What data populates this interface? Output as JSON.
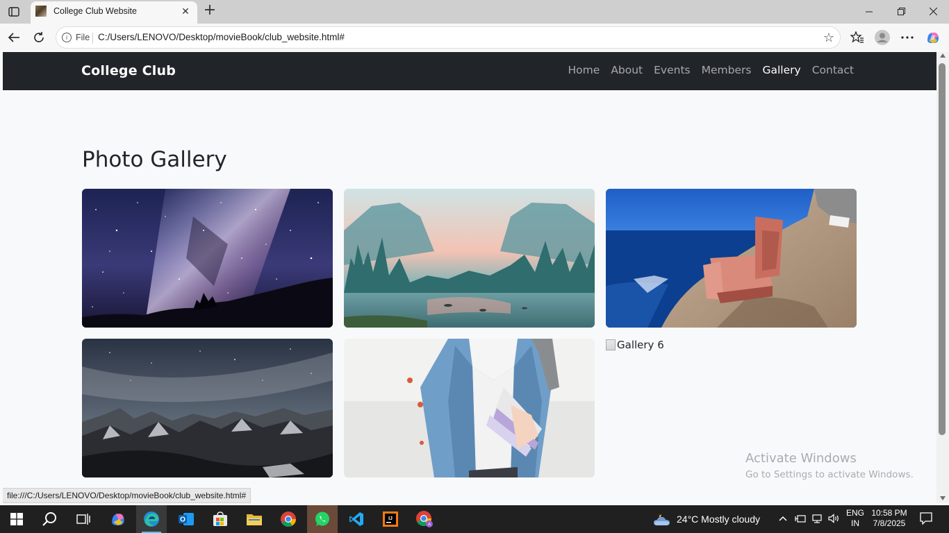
{
  "browser": {
    "tab_title": "College Club Website",
    "address_prefix": "File",
    "url": "C:/Users/LENOVO/Desktop/movieBook/club_website.html#",
    "status_url": "file:///C:/Users/LENOVO/Desktop/movieBook/club_website.html#"
  },
  "site": {
    "brand": "College Club",
    "nav": [
      {
        "label": "Home",
        "active": false
      },
      {
        "label": "About",
        "active": false
      },
      {
        "label": "Events",
        "active": false
      },
      {
        "label": "Members",
        "active": false
      },
      {
        "label": "Gallery",
        "active": true
      },
      {
        "label": "Contact",
        "active": false
      }
    ]
  },
  "gallery": {
    "title": "Photo Gallery",
    "images": [
      {
        "subject": "milky way night sky over hill silhouette",
        "loaded": true
      },
      {
        "subject": "misty valley with pine trees and river at sunrise",
        "loaded": true
      },
      {
        "subject": "pink armchair on rocky coast by the sea",
        "loaded": true
      },
      {
        "subject": "starry sky over snowy mountain range",
        "loaded": true
      },
      {
        "subject": "student in denim jacket holding books",
        "loaded": true
      },
      {
        "alt": "Gallery 6",
        "loaded": false
      }
    ]
  },
  "watermark": {
    "line1": "Activate Windows",
    "line2": "Go to Settings to activate Windows."
  },
  "taskbar": {
    "weather": "24°C  Mostly cloudy",
    "lang_line1": "ENG",
    "lang_line2": "IN",
    "time": "10:58 PM",
    "date": "7/8/2025"
  }
}
